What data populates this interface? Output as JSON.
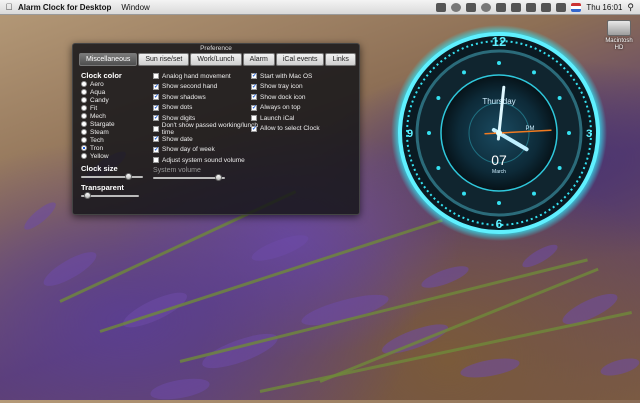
{
  "menubar": {
    "app_name": "Alarm Clock for Desktop",
    "menus": [
      "Window"
    ],
    "clock": "Thu 16:01"
  },
  "desktop": {
    "drive_label": "Macintosh HD"
  },
  "panel": {
    "title": "Preference",
    "tabs": [
      "Miscellaneous",
      "Sun rise/set",
      "Work/Lunch",
      "Alarm",
      "iCal events",
      "Links"
    ],
    "active_tab": 0,
    "clock_color_title": "Clock color",
    "colors": [
      "Aero",
      "Aqua",
      "Candy",
      "Fit",
      "Mech",
      "Stargate",
      "Steam",
      "Tech",
      "Tron",
      "Yellow"
    ],
    "selected_color": "Tron",
    "clock_size_label": "Clock size",
    "clock_size_value": 0.8,
    "transparent_label": "Transparent",
    "transparent_value": 0.05,
    "system_volume_label": "System volume",
    "system_volume_value": 0.95,
    "options_col1": [
      {
        "label": "Analog hand movement",
        "checked": false
      },
      {
        "label": "Show second hand",
        "checked": true
      },
      {
        "label": "Show shadows",
        "checked": true
      },
      {
        "label": "Show dots",
        "checked": true
      },
      {
        "label": "Show digits",
        "checked": true
      },
      {
        "label": "Don't show passed working/lunch time",
        "checked": false
      },
      {
        "label": "Show date",
        "checked": true
      },
      {
        "label": "Show day of week",
        "checked": true
      },
      {
        "label": "Adjust system sound volume",
        "checked": false
      }
    ],
    "options_col2": [
      {
        "label": "Start with Mac OS",
        "checked": true
      },
      {
        "label": "Show tray icon",
        "checked": true
      },
      {
        "label": "Show dock icon",
        "checked": true
      },
      {
        "label": "Always on top",
        "checked": true
      },
      {
        "label": "Launch iCal",
        "checked": false
      },
      {
        "label": "Allow to select Clock",
        "checked": true
      }
    ]
  },
  "clock_widget": {
    "day_name": "Thursday",
    "ampm": "PM",
    "date": "07",
    "month": "March",
    "numerals": [
      "12",
      "3",
      "6",
      "9"
    ],
    "hour": 16,
    "minute": 1,
    "colors": {
      "accent": "#35e0f0",
      "second_hand": "#f07a20"
    }
  }
}
